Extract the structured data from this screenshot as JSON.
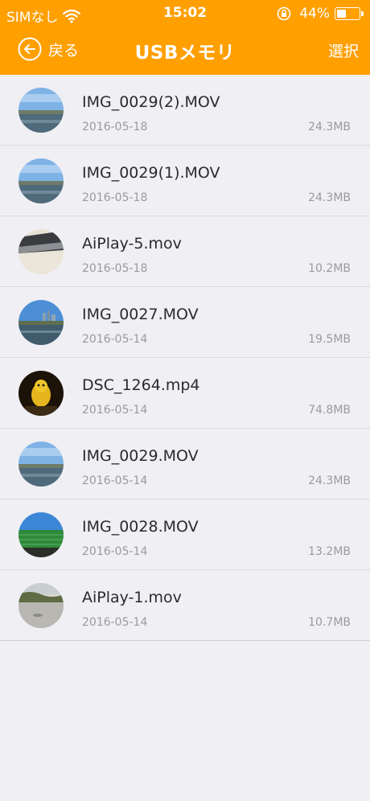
{
  "status_bar": {
    "carrier": "SIMなし",
    "time": "15:02",
    "battery": "44%",
    "battery_level": 0.44
  },
  "nav": {
    "back_label": "戻る",
    "title": "USBメモリ",
    "select_label": "選択"
  },
  "colors": {
    "accent": "#ff9f00",
    "background": "#efeff4",
    "secondary_text": "#9a9aa0"
  },
  "files": [
    {
      "name": "IMG_0029(2).MOV",
      "date": "2016-05-18",
      "size": "24.3MB",
      "thumb": "river-sky"
    },
    {
      "name": "IMG_0029(1).MOV",
      "date": "2016-05-18",
      "size": "24.3MB",
      "thumb": "river-sky"
    },
    {
      "name": "AiPlay-5.mov",
      "date": "2016-05-18",
      "size": "10.2MB",
      "thumb": "device-closeup"
    },
    {
      "name": "IMG_0027.MOV",
      "date": "2016-05-14",
      "size": "19.5MB",
      "thumb": "river-city"
    },
    {
      "name": "DSC_1264.mp4",
      "date": "2016-05-14",
      "size": "74.8MB",
      "thumb": "yellow-toy-dark"
    },
    {
      "name": "IMG_0029.MOV",
      "date": "2016-05-14",
      "size": "24.3MB",
      "thumb": "river-sky"
    },
    {
      "name": "IMG_0028.MOV",
      "date": "2016-05-14",
      "size": "13.2MB",
      "thumb": "green-fence"
    },
    {
      "name": "AiPlay-1.mov",
      "date": "2016-05-14",
      "size": "10.7MB",
      "thumb": "riverbank-grey"
    }
  ]
}
